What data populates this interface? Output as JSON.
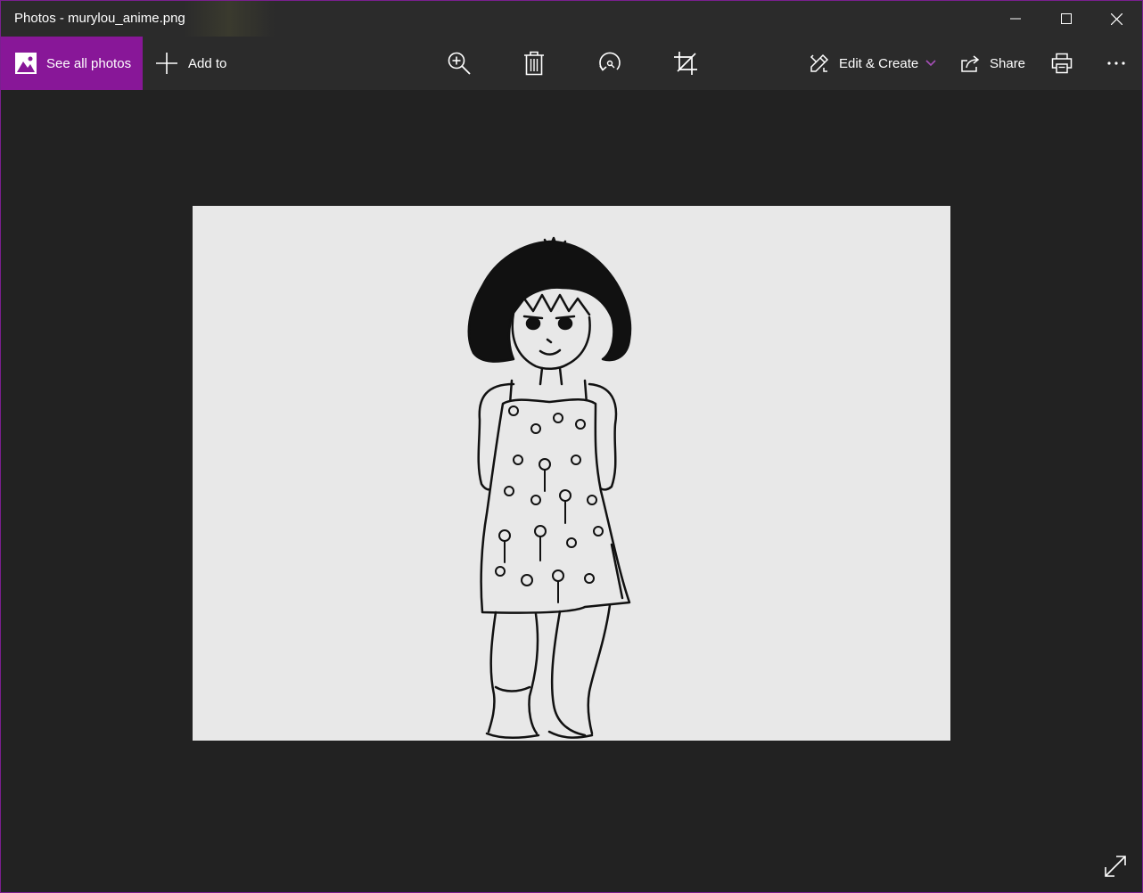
{
  "window": {
    "title": "Photos - murylou_anime.png",
    "controls": [
      "minimize",
      "maximize",
      "close"
    ]
  },
  "toolbar": {
    "see_all_label": "See all photos",
    "add_to_label": "Add to",
    "edit_create_label": "Edit & Create",
    "share_label": "Share",
    "accent_color": "#881798",
    "icons": [
      "zoom-in-icon",
      "delete-icon",
      "rotate-icon",
      "crop-icon",
      "edit-create-icon",
      "share-icon",
      "print-icon",
      "more-options-icon"
    ]
  },
  "viewer": {
    "image_name": "murylou_anime.png",
    "background": "#222222",
    "image_background": "#e8e8e8"
  }
}
